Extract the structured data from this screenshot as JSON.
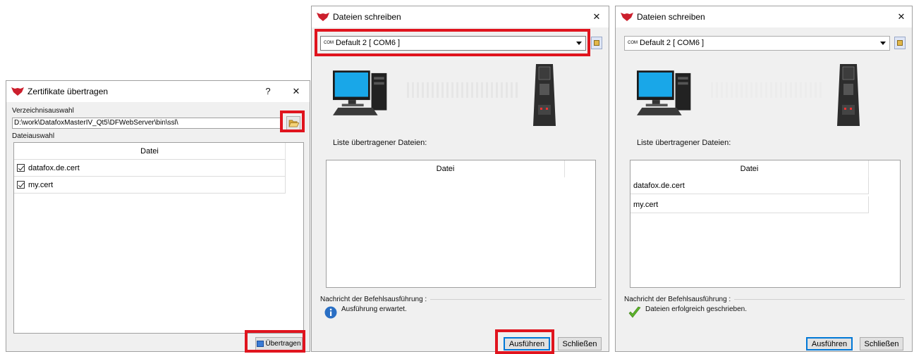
{
  "windows": {
    "cert": {
      "title": "Zertifikate übertragen",
      "help": "?",
      "close": "✕",
      "dir_label": "Verzeichnisauswahl",
      "dir_path": "D:\\work\\DatafoxMasterIV_Qt5\\DFWebServer\\bin\\ssl\\",
      "file_label": "Dateiauswahl",
      "column": "Datei",
      "files": [
        "datafox.de.cert",
        "my.cert"
      ],
      "transfer_button": "Übertragen"
    },
    "write1": {
      "title": "Dateien schreiben",
      "close": "✕",
      "com_tag": "COM",
      "device": "Default 2 [ COM6 ]",
      "list_label": "Liste übertragener Dateien:",
      "column": "Datei",
      "files": [],
      "msg_label": "Nachricht der Befehlsausführung :",
      "msg_text": "Ausführung erwartet.",
      "run_button": "Ausführen",
      "close_button": "Schließen"
    },
    "write2": {
      "title": "Dateien schreiben",
      "close": "✕",
      "com_tag": "COM",
      "device": "Default 2 [ COM6 ]",
      "list_label": "Liste übertragener Dateien:",
      "column": "Datei",
      "files": [
        "datafox.de.cert",
        "my.cert"
      ],
      "msg_label": "Nachricht der Befehlsausführung :",
      "msg_text": "Dateien erfolgreich geschrieben.",
      "run_button": "Ausführen",
      "close_button": "Schließen"
    }
  },
  "colors": {
    "highlight": "#e0141e",
    "brand": "#cc1f2d",
    "accent": "#0078d7"
  }
}
